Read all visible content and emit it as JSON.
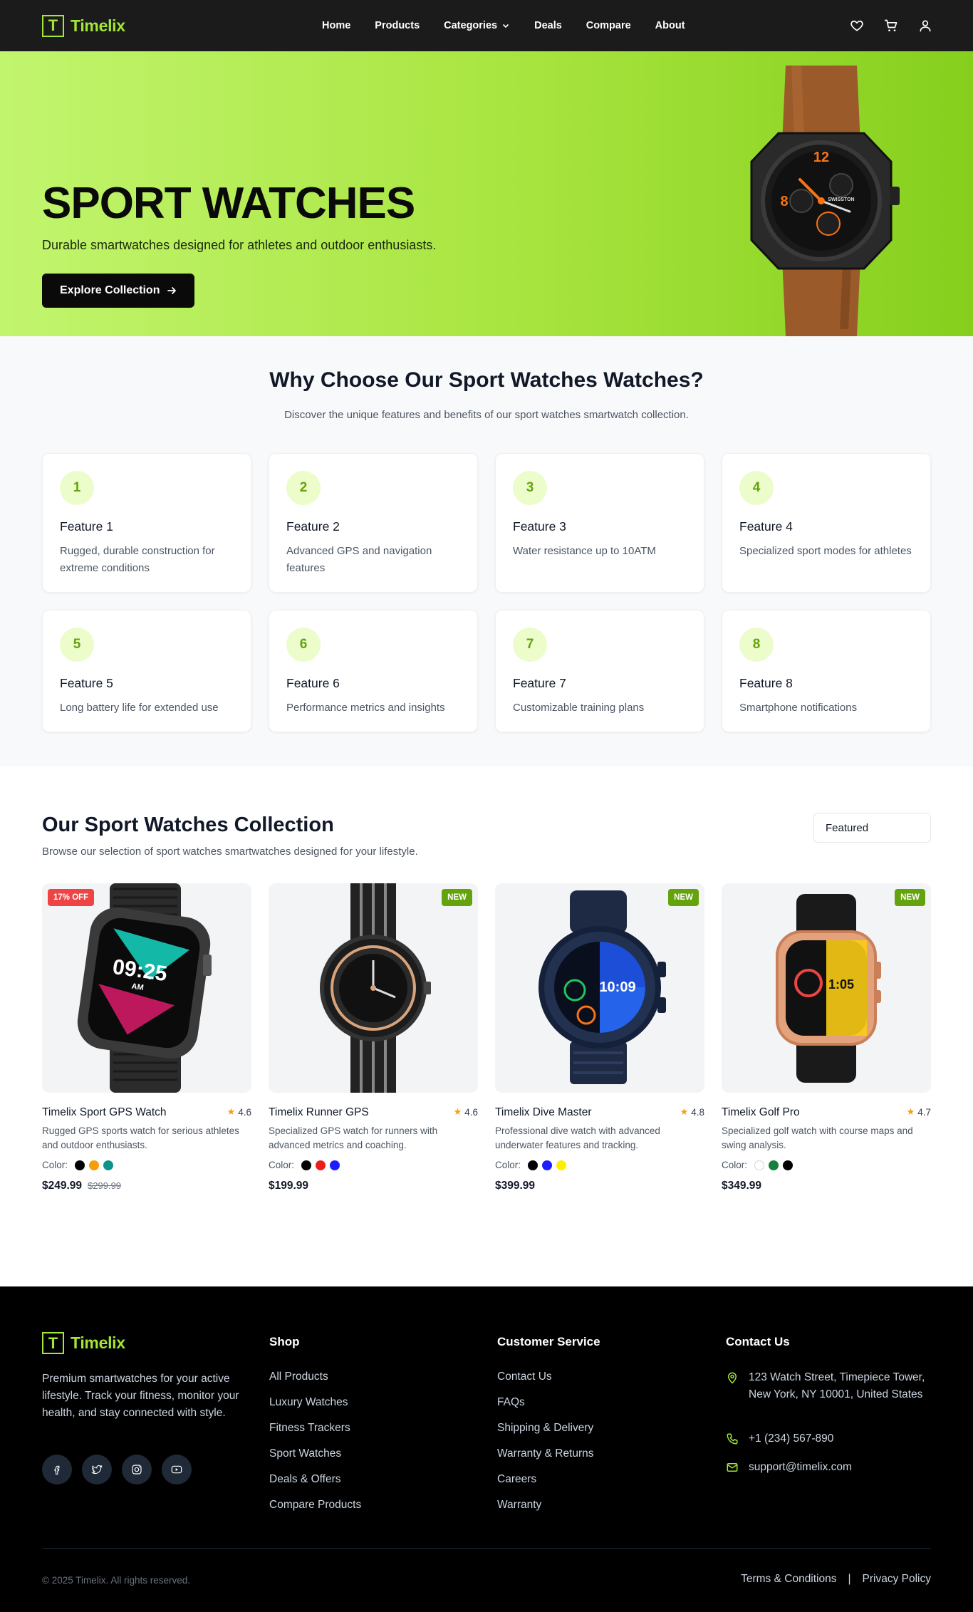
{
  "brand": {
    "logo_letter": "T",
    "name": "Timelix",
    "accent": "#a3e635"
  },
  "nav": {
    "items": [
      {
        "label": "Home"
      },
      {
        "label": "Products"
      },
      {
        "label": "Categories",
        "has_dropdown": true
      },
      {
        "label": "Deals"
      },
      {
        "label": "Compare"
      },
      {
        "label": "About"
      }
    ],
    "icons": [
      "heart-icon",
      "cart-icon",
      "user-icon"
    ]
  },
  "hero": {
    "title": "SPORT WATCHES",
    "subtitle": "Durable smartwatches designed for athletes and outdoor enthusiasts.",
    "cta_label": "Explore Collection",
    "watch_brand": "SWISSTON"
  },
  "features": {
    "title": "Why Choose Our Sport Watches Watches?",
    "subtitle": "Discover the unique features and benefits of our sport watches smartwatch collection.",
    "items": [
      {
        "num": "1",
        "name": "Feature 1",
        "desc": "Rugged, durable construction for extreme conditions"
      },
      {
        "num": "2",
        "name": "Feature 2",
        "desc": "Advanced GPS and navigation features"
      },
      {
        "num": "3",
        "name": "Feature 3",
        "desc": "Water resistance up to 10ATM"
      },
      {
        "num": "4",
        "name": "Feature 4",
        "desc": "Specialized sport modes for athletes"
      },
      {
        "num": "5",
        "name": "Feature 5",
        "desc": "Long battery life for extended use"
      },
      {
        "num": "6",
        "name": "Feature 6",
        "desc": "Performance metrics and insights"
      },
      {
        "num": "7",
        "name": "Feature 7",
        "desc": "Customizable training plans"
      },
      {
        "num": "8",
        "name": "Feature 8",
        "desc": "Smartphone notifications"
      }
    ]
  },
  "collection": {
    "title": "Our Sport Watches Collection",
    "subtitle": "Browse our selection of sport watches smartwatches designed for your lifestyle.",
    "sort_selected": "Featured",
    "color_label": "Color:",
    "products": [
      {
        "name": "Timelix Sport GPS Watch",
        "rating": "4.6",
        "desc": "Rugged GPS sports watch for serious athletes and outdoor enthusiasts.",
        "colors": [
          "#000000",
          "#f59e0b",
          "#0d9488"
        ],
        "price": "$249.99",
        "old_price": "$299.99",
        "badge": "17% OFF",
        "badge_type": "sale",
        "screen_time": "09:25",
        "screen_ampm": "AM"
      },
      {
        "name": "Timelix Runner GPS",
        "rating": "4.6",
        "desc": "Specialized GPS watch for runners with advanced metrics and coaching.",
        "colors": [
          "#000000",
          "#ef1c1c",
          "#1d1dff"
        ],
        "price": "$199.99",
        "old_price": "",
        "badge": "NEW",
        "badge_type": "new"
      },
      {
        "name": "Timelix Dive Master",
        "rating": "4.8",
        "desc": "Professional dive watch with advanced underwater features and tracking.",
        "colors": [
          "#000000",
          "#1d1dff",
          "#ffee00"
        ],
        "price": "$399.99",
        "old_price": "",
        "badge": "NEW",
        "badge_type": "new",
        "screen_time": "10:09"
      },
      {
        "name": "Timelix Golf Pro",
        "rating": "4.7",
        "desc": "Specialized golf watch with course maps and swing analysis.",
        "colors": [
          "#ffffff",
          "#15803d",
          "#000000"
        ],
        "price": "$349.99",
        "old_price": "",
        "badge": "NEW",
        "badge_type": "new",
        "screen_time": "1:05"
      }
    ]
  },
  "footer": {
    "about": "Premium smartwatches for your active lifestyle. Track your fitness, monitor your health, and stay connected with style.",
    "social_icons": [
      "facebook-icon",
      "twitter-icon",
      "instagram-icon",
      "youtube-icon"
    ],
    "shop": {
      "title": "Shop",
      "links": [
        "All Products",
        "Luxury Watches",
        "Fitness Trackers",
        "Sport Watches",
        "Deals & Offers",
        "Compare Products"
      ]
    },
    "service": {
      "title": "Customer Service",
      "links": [
        "Contact Us",
        "FAQs",
        "Shipping & Delivery",
        "Warranty & Returns",
        "Careers",
        "Warranty"
      ]
    },
    "contact": {
      "title": "Contact Us",
      "address": "123 Watch Street, Timepiece Tower, New York, NY 10001, United States",
      "phone": "+1 (234) 567-890",
      "email": "support@timelix.com"
    },
    "copyright": "© 2025 Timelix. All rights reserved.",
    "terms": "Terms & Conditions",
    "separator": "|",
    "privacy": "Privacy Policy"
  }
}
